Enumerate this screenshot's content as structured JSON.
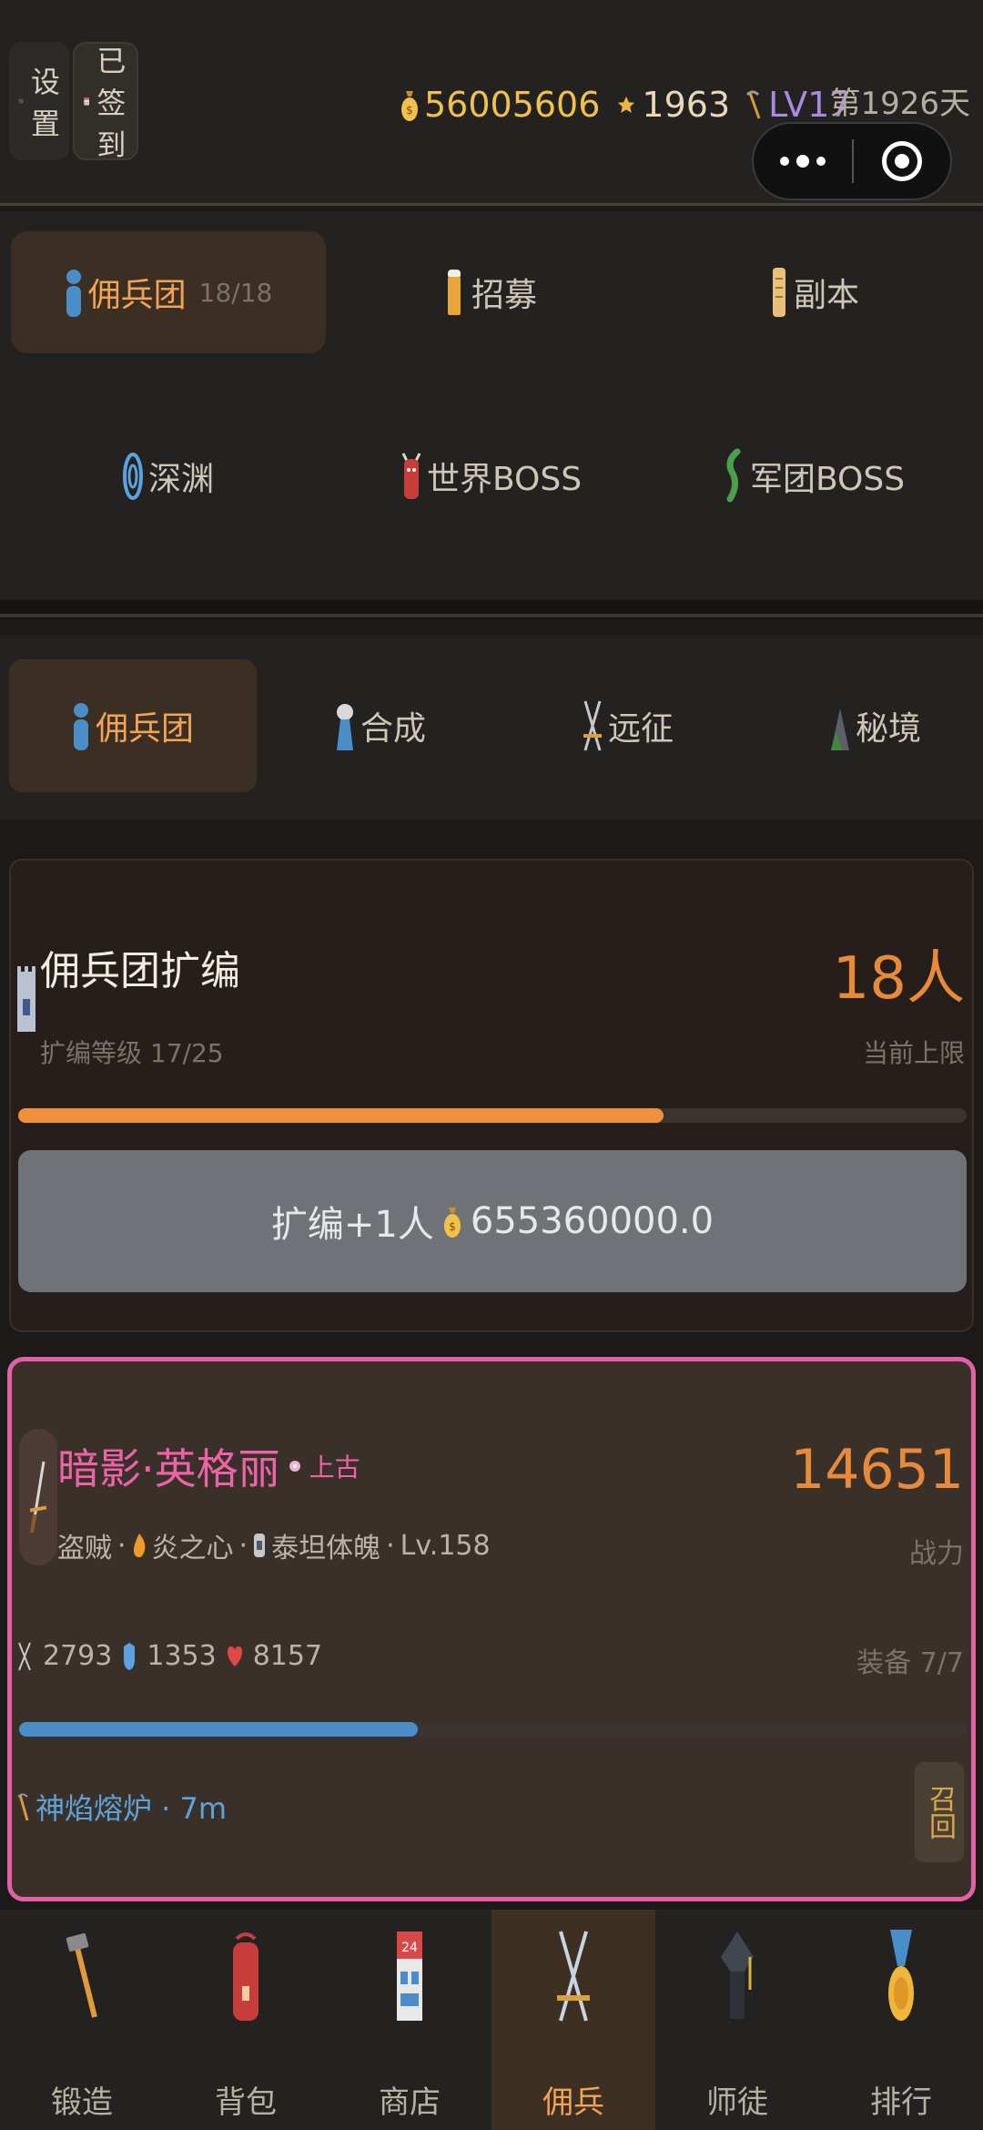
{
  "topbar": {
    "settings_label": "设置",
    "signed_label": "已签到",
    "gold": "56005606",
    "stars": "1963",
    "level": "LV17",
    "day": "第1926天"
  },
  "nav_grid": [
    {
      "label": "佣兵团",
      "sub": "18/18"
    },
    {
      "label": "招募"
    },
    {
      "label": "副本"
    },
    {
      "label": "深渊"
    },
    {
      "label": "世界BOSS"
    },
    {
      "label": "军团BOSS"
    }
  ],
  "tabs": [
    {
      "label": "佣兵团"
    },
    {
      "label": "合成"
    },
    {
      "label": "远征"
    },
    {
      "label": "秘境"
    }
  ],
  "expand_card": {
    "title": "佣兵团扩编",
    "level_text": "扩编等级 17/25",
    "count": "18人",
    "cap_label": "当前上限",
    "progress": 0.68,
    "button_label": "扩编+1人",
    "button_cost": "655360000.0"
  },
  "merc_card": {
    "name": "暗影·英格丽",
    "rarity": "上古",
    "tags": "盗贼 · 炎之心 · 泰坦体魄 · Lv.158",
    "tag_class": "盗贼",
    "tag_fire": "炎之心",
    "tag_titan": "泰坦体魄",
    "tag_level": "Lv.158",
    "power": "14651",
    "power_label": "战力",
    "atk": "2793",
    "def": "1353",
    "hp": "8157",
    "equip": "装备 7/7",
    "progress": 0.42,
    "task": "神焰熔炉 · 7m",
    "recall_label": "召回"
  },
  "bottom_nav": [
    {
      "label": "锻造"
    },
    {
      "label": "背包"
    },
    {
      "label": "商店"
    },
    {
      "label": "佣兵"
    },
    {
      "label": "师徒"
    },
    {
      "label": "排行"
    }
  ]
}
